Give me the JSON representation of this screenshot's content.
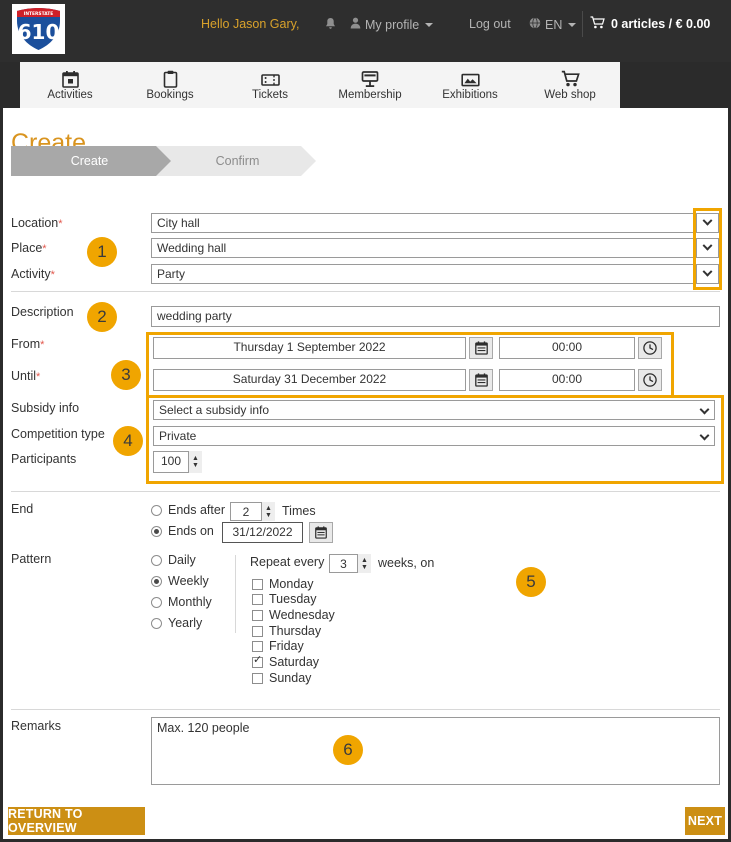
{
  "header": {
    "logo": {
      "name": "interstate-610-shield",
      "top_text": "INTERSTATE",
      "number": "610"
    },
    "greeting": "Hello Jason Gary,",
    "bell_icon": "bell-icon",
    "profile_icon": "user-icon",
    "profile_label": "My profile",
    "logout_label": "Log out",
    "globe_icon": "globe-icon",
    "language": "EN",
    "cart_icon": "cart-icon",
    "cart_label": "0 articles / € 0.00"
  },
  "nav": {
    "items": [
      {
        "label": "Activities",
        "icon": "calendar-icon"
      },
      {
        "label": "Bookings",
        "icon": "clipboard-icon"
      },
      {
        "label": "Tickets",
        "icon": "ticket-icon"
      },
      {
        "label": "Membership",
        "icon": "membership-card-icon"
      },
      {
        "label": "Exhibitions",
        "icon": "picture-frame-icon"
      },
      {
        "label": "Web shop",
        "icon": "shopping-cart-icon"
      }
    ]
  },
  "page": {
    "title": "Create",
    "steps": [
      {
        "label": "Create",
        "state": "active"
      },
      {
        "label": "Confirm",
        "state": "upcoming"
      }
    ]
  },
  "form": {
    "location": {
      "label": "Location",
      "required": "*",
      "value": "City hall"
    },
    "place": {
      "label": "Place",
      "required": "*",
      "value": "Wedding hall"
    },
    "activity": {
      "label": "Activity",
      "required": "*",
      "value": "Party"
    },
    "description": {
      "label": "Description",
      "value": "wedding party"
    },
    "from": {
      "label": "From",
      "required": "*",
      "date": "Thursday 1 September 2022",
      "time": "00:00",
      "date_icon": "calendar-icon",
      "time_icon": "clock-icon"
    },
    "until": {
      "label": "Until",
      "required": "*",
      "date": "Saturday 31 December 2022",
      "time": "00:00",
      "date_icon": "calendar-icon",
      "time_icon": "clock-icon"
    },
    "subsidy": {
      "label": "Subsidy info",
      "value": "Select a subsidy info"
    },
    "competition": {
      "label": "Competition type",
      "value": "Private"
    },
    "participants": {
      "label": "Participants",
      "value": "100"
    }
  },
  "end": {
    "label": "End",
    "ends_after": {
      "label": "Ends after",
      "selected": false,
      "count": "2",
      "suffix": "Times"
    },
    "ends_on": {
      "label": "Ends on",
      "selected": true,
      "date": "31/12/2022",
      "icon": "calendar-icon"
    }
  },
  "pattern": {
    "label": "Pattern",
    "options": [
      {
        "label": "Daily",
        "selected": false
      },
      {
        "label": "Weekly",
        "selected": true
      },
      {
        "label": "Monthly",
        "selected": false
      },
      {
        "label": "Yearly",
        "selected": false
      }
    ],
    "repeat_prefix": "Repeat every",
    "repeat_value": "3",
    "repeat_suffix": "weeks, on",
    "days": [
      {
        "label": "Monday",
        "checked": false
      },
      {
        "label": "Tuesday",
        "checked": false
      },
      {
        "label": "Wednesday",
        "checked": false
      },
      {
        "label": "Thursday",
        "checked": false
      },
      {
        "label": "Friday",
        "checked": false
      },
      {
        "label": "Saturday",
        "checked": true
      },
      {
        "label": "Sunday",
        "checked": false
      }
    ]
  },
  "remarks": {
    "label": "Remarks",
    "value": "Max. 120 people"
  },
  "footer": {
    "back_label": "RETURN TO OVERVIEW",
    "next_label": "NEXT"
  },
  "callouts": [
    {
      "number": "1"
    },
    {
      "number": "2"
    },
    {
      "number": "3"
    },
    {
      "number": "4"
    },
    {
      "number": "5"
    },
    {
      "number": "6"
    }
  ],
  "colors": {
    "accent_orange": "#f0a500",
    "title_orange": "#d9941f",
    "button_gold": "#cc8f14",
    "header_dark": "#2e2e2e",
    "required_red": "#e2574c"
  }
}
